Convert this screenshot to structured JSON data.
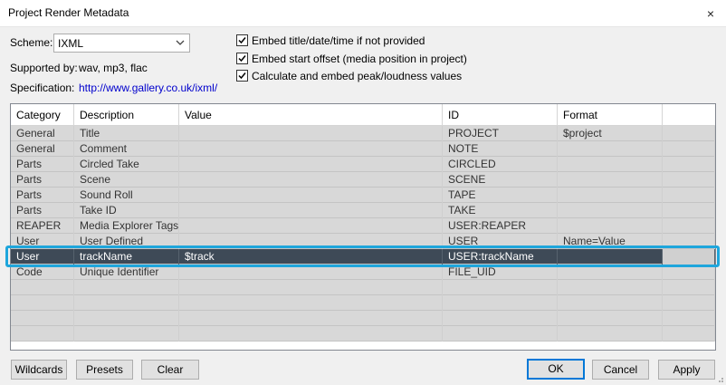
{
  "window": {
    "title": "Project Render Metadata",
    "close_glyph": "×"
  },
  "scheme": {
    "label": "Scheme:",
    "value": "IXML"
  },
  "supported": {
    "label": "Supported by:",
    "value": "wav, mp3, flac"
  },
  "spec": {
    "label": "Specification:",
    "url": "http://www.gallery.co.uk/ixml/"
  },
  "options": [
    {
      "label": "Embed title/date/time if not provided",
      "checked": true
    },
    {
      "label": "Embed start offset (media position in project)",
      "checked": true
    },
    {
      "label": "Calculate and embed peak/loudness values",
      "checked": true
    }
  ],
  "table": {
    "headers": [
      "Category",
      "Description",
      "Value",
      "ID",
      "Format"
    ],
    "rows": [
      [
        "General",
        "Title",
        "",
        "PROJECT",
        "$project"
      ],
      [
        "General",
        "Comment",
        "",
        "NOTE",
        ""
      ],
      [
        "Parts",
        "Circled Take",
        "",
        "CIRCLED",
        ""
      ],
      [
        "Parts",
        "Scene",
        "",
        "SCENE",
        ""
      ],
      [
        "Parts",
        "Sound Roll",
        "",
        "TAPE",
        ""
      ],
      [
        "Parts",
        "Take ID",
        "",
        "TAKE",
        ""
      ],
      [
        "REAPER",
        "Media Explorer Tags",
        "",
        "USER:REAPER",
        ""
      ],
      [
        "User",
        "User Defined",
        "",
        "USER",
        "Name=Value"
      ],
      [
        "User",
        "trackName",
        "$track",
        "USER:trackName",
        ""
      ],
      [
        "Code",
        "Unique Identifier",
        "",
        "FILE_UID",
        ""
      ]
    ],
    "selected_row": 8
  },
  "buttons": {
    "wildcards": "Wildcards",
    "presets": "Presets",
    "clear": "Clear",
    "ok": "OK",
    "cancel": "Cancel",
    "apply": "Apply"
  },
  "colors": {
    "selection": "#3e4a57",
    "highlight_ring": "#1ea6dc",
    "link": "#0000cc"
  }
}
